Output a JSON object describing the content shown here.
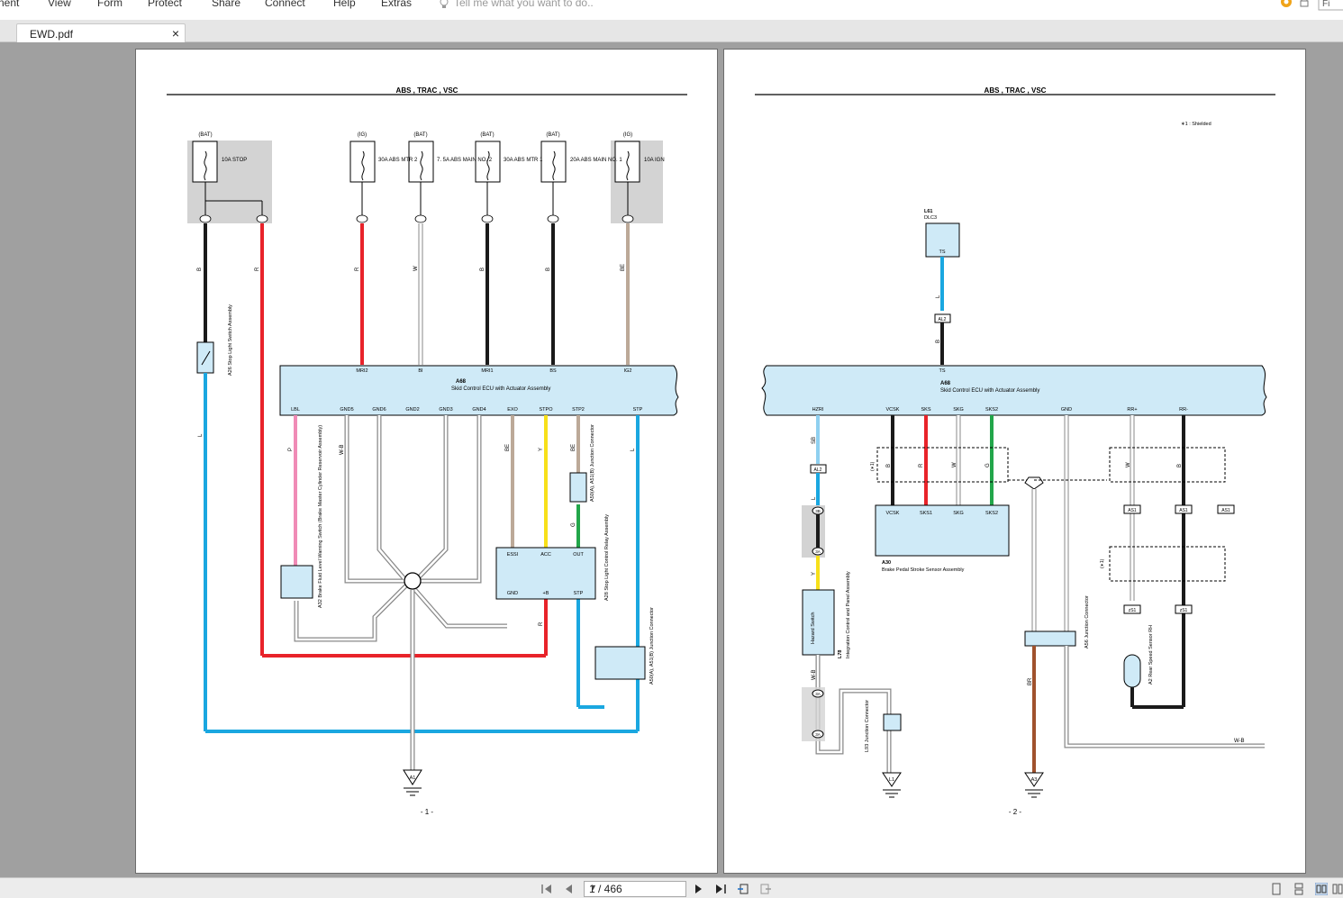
{
  "menu": {
    "items": [
      "nent",
      "View",
      "Form",
      "Protect",
      "Share",
      "Connect",
      "Help",
      "Extras"
    ],
    "tell_me": "Tell me what you want to do.."
  },
  "search": {
    "partial_label": "Fi"
  },
  "tab": {
    "title": "EWD.pdf",
    "close": "×"
  },
  "pages": [
    {
      "header": "ABS , TRAC , VSC",
      "footer": "- 1 -"
    },
    {
      "header": "ABS , TRAC , VSC",
      "footer": "- 2 -",
      "note": "∗1 : Shielded"
    }
  ],
  "nav": {
    "page_indicator": "1 / 466"
  },
  "colors": {
    "wire_black": "#1a1a1a",
    "wire_red": "#e8232a",
    "wire_blue": "#1aa7e0",
    "wire_pink": "#f08bb6",
    "wire_beige": "#bca998",
    "wire_yellow": "#f7e01a",
    "wire_green": "#22a64a",
    "wire_lightblue": "#8fd0f0",
    "wire_brown": "#a0522d",
    "ecu_fill": "#cfeaf7",
    "fuse_bg": "#d3d3d3"
  },
  "diagram1": {
    "fuse_labels": [
      "(BAT)",
      "(IG)",
      "(BAT)",
      "(BAT)",
      "(BAT)",
      "(IG)"
    ],
    "fuse_names": [
      "10A STOP",
      "30A ABS MTR 2",
      "7. 5A ABS MAIN NO. 2",
      "30A ABS MTR 1",
      "20A ABS MAIN NO. 1",
      "10A IGN"
    ],
    "ecu_id": "A68",
    "ecu_name": "Skid Control ECU with Actuator Assembly",
    "top_pins": [
      "MRI2",
      "BI",
      "MRI1",
      "BS",
      "IG2"
    ],
    "bottom_pins": [
      "LBL",
      "GND5",
      "GND6",
      "GND2",
      "GND3",
      "GND4",
      "EXO",
      "STPO",
      "STP2",
      "STP"
    ],
    "wire_codes": [
      "B",
      "R",
      "R",
      "W",
      "B",
      "B",
      "BE",
      "P",
      "W-B",
      "BE",
      "Y",
      "BE",
      "L",
      "G",
      "L",
      "R"
    ],
    "components": [
      "A26 Stop Light Switch Assembly",
      "A32 Brake Fluid Level Warning Switch (Brake Master Cylinder Reservoir Assembly)",
      "A28 Stop Light Control Relay Assembly",
      "A50(A), A51(B) Junction Connector",
      "A50(A), A51(B) Junction Connector"
    ],
    "relay_pins": [
      "ESSI",
      "ACC",
      "OUT",
      "GND",
      "+B",
      "STP"
    ],
    "ground": "A1"
  },
  "diagram2": {
    "dlc": {
      "id": "L61",
      "name": "DLC3",
      "pin": "TS"
    },
    "ecu_id": "A68",
    "ecu_name": "Skid Control ECU with Actuator Assembly",
    "top_pin": "TS",
    "bottom_pins": [
      "HZRI",
      "VCSK",
      "SKS",
      "SKG",
      "SKS2",
      "GND",
      "RR+",
      "RR-"
    ],
    "sensor": {
      "id": "A30",
      "name": "Brake Pedal Stroke Sensor Assembly",
      "pins": [
        "VCSK",
        "SKS1",
        "SKG",
        "SKS2"
      ]
    },
    "hazard": {
      "id": "L78",
      "name": "Hazard Switch",
      "desc": "Integration Control and Panel Assembly"
    },
    "junctions": [
      "L93 Junction Connector",
      "A56 Junction Connector"
    ],
    "speed_sensor": "A2 Rear Speed Sensor RH",
    "connectors": [
      "AL2",
      "AL2",
      "3B",
      "3A",
      "3A",
      "3A",
      "AS1",
      "AS1",
      "AS1",
      "zS1",
      "zS1"
    ],
    "grounds": [
      "L1",
      "A3"
    ],
    "shield_tag": "(∗1)",
    "wire_codes": [
      "L",
      "B",
      "SB",
      "L",
      "Y",
      "W-B",
      "B",
      "R",
      "W",
      "G",
      "W",
      "B",
      "BR",
      "W-B"
    ]
  }
}
